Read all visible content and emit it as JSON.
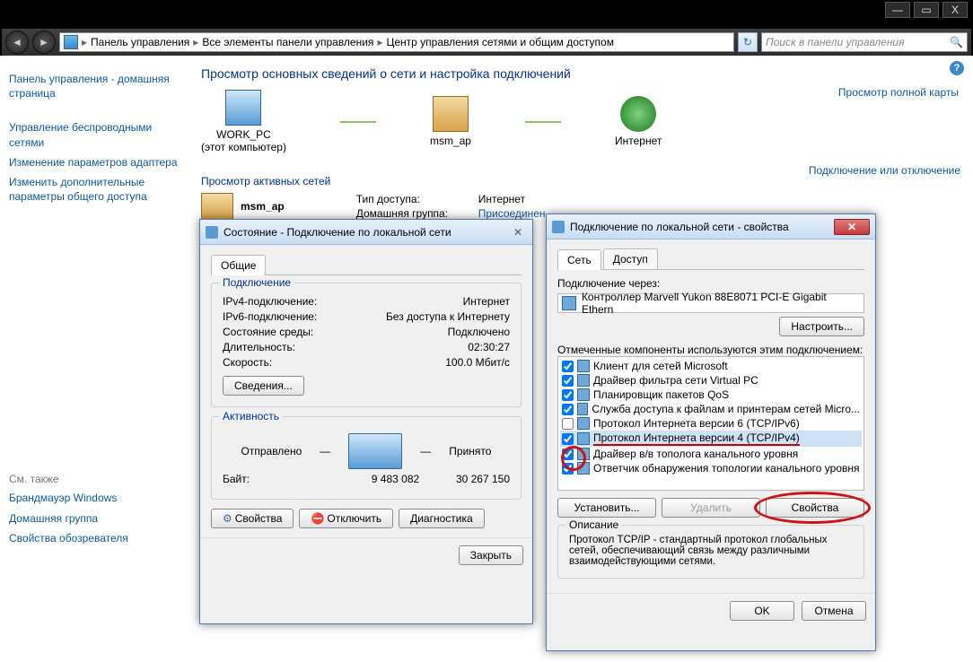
{
  "window_controls": {
    "min": "—",
    "max": "▭",
    "close": "X"
  },
  "breadcrumb": {
    "items": [
      "Панель управления",
      "Все элементы панели управления",
      "Центр управления сетями и общим доступом"
    ]
  },
  "search": {
    "placeholder": "Поиск в панели управления"
  },
  "sidebar": {
    "home": "Панель управления - домашняя страница",
    "links": [
      "Управление беспроводными сетями",
      "Изменение параметров адаптера",
      "Изменить дополнительные параметры общего доступа"
    ],
    "see_also_label": "См. также",
    "see_also": [
      "Брандмауэр Windows",
      "Домашняя группа",
      "Свойства обозревателя"
    ]
  },
  "main": {
    "heading": "Просмотр основных сведений о сети и настройка подключений",
    "full_map": "Просмотр полной карты",
    "nodes": {
      "pc": "WORK_PC",
      "pc_sub": "(этот компьютер)",
      "ap": "msm_ap",
      "inet": "Интернет"
    },
    "active_nets": "Просмотр активных сетей",
    "connect": "Подключение или отключение",
    "net_name": "msm_ap",
    "kv": {
      "type_lbl": "Тип доступа:",
      "type_val": "Интернет",
      "hg_lbl": "Домашняя группа:",
      "hg_val": "Присоединен"
    }
  },
  "status_dialog": {
    "title": "Состояние - Подключение по локальной сети",
    "tab_general": "Общие",
    "grp_conn": "Подключение",
    "rows": {
      "v4_lbl": "IPv4-подключение:",
      "v4_val": "Интернет",
      "v6_lbl": "IPv6-подключение:",
      "v6_val": "Без доступа к Интернету",
      "media_lbl": "Состояние среды:",
      "media_val": "Подключено",
      "dur_lbl": "Длительность:",
      "dur_val": "02:30:27",
      "spd_lbl": "Скорость:",
      "spd_val": "100.0 Мбит/с"
    },
    "details_btn": "Сведения...",
    "grp_act": "Активность",
    "sent_lbl": "Отправлено",
    "recv_lbl": "Принято",
    "bytes_lbl": "Байт:",
    "sent_val": "9 483 082",
    "recv_val": "30 267 150",
    "props_btn": "Свойства",
    "disable_btn": "Отключить",
    "diag_btn": "Диагностика",
    "close_btn": "Закрыть"
  },
  "props_dialog": {
    "title": "Подключение по локальной сети - свойства",
    "tab_net": "Сеть",
    "tab_access": "Доступ",
    "connect_via": "Подключение через:",
    "adapter": "Контроллер Marvell Yukon 88E8071 PCI-E Gigabit Ethern",
    "configure_btn": "Настроить...",
    "components_label": "Отмеченные компоненты используются этим подключением:",
    "components": [
      {
        "checked": true,
        "label": "Клиент для сетей Microsoft"
      },
      {
        "checked": true,
        "label": "Драйвер фильтра сети Virtual PC"
      },
      {
        "checked": true,
        "label": "Планировщик пакетов QoS"
      },
      {
        "checked": true,
        "label": "Служба доступа к файлам и принтерам сетей Micro..."
      },
      {
        "checked": false,
        "label": "Протокол Интернета версии 6 (TCP/IPv6)"
      },
      {
        "checked": true,
        "label": "Протокол Интернета версии 4 (TCP/IPv4)",
        "selected": true
      },
      {
        "checked": true,
        "label": "Драйвер в/в тополога канального уровня"
      },
      {
        "checked": true,
        "label": "Ответчик обнаружения топологии канального уровня"
      }
    ],
    "install_btn": "Установить...",
    "remove_btn": "Удалить",
    "props_btn": "Свойства",
    "desc_label": "Описание",
    "desc_text": "Протокол TCP/IP - стандартный протокол глобальных сетей, обеспечивающий связь между различными взаимодействующими сетями.",
    "ok_btn": "OK",
    "cancel_btn": "Отмена"
  }
}
